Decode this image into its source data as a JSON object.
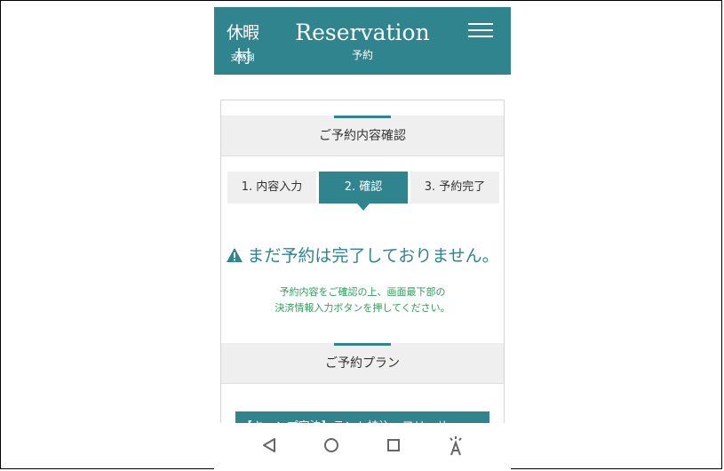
{
  "header": {
    "logo_main": "休暇村",
    "logo_sub": "支笏湖",
    "title": "Reservation",
    "subtitle": "予約",
    "menu_icon": "hamburger-menu-icon"
  },
  "confirm_section": {
    "heading": "ご予約内容確認"
  },
  "steps": [
    {
      "label": "1. 内容入力",
      "active": false
    },
    {
      "label": "2. 確認",
      "active": true
    },
    {
      "label": "3. 予約完了",
      "active": false
    }
  ],
  "warning": {
    "icon": "warning-triangle-icon",
    "text": "まだ予約は完了しておりません。",
    "note_line1": "予約内容をご確認の上、画面最下部の",
    "note_line2": "決済情報入力ボタンを押してください。"
  },
  "plan_section": {
    "heading": "ご予約プラン",
    "plan_title": "【キャンプ宿泊】テント持込　フリーサ"
  },
  "nav_bar": {
    "back_icon": "back-triangle-icon",
    "home_icon": "home-circle-icon",
    "recents_icon": "recents-square-icon",
    "accessibility_icon": "accessibility-icon"
  },
  "colors": {
    "brand": "#2f848e",
    "note_green": "#2e9d59",
    "section_bg": "#efefef"
  }
}
